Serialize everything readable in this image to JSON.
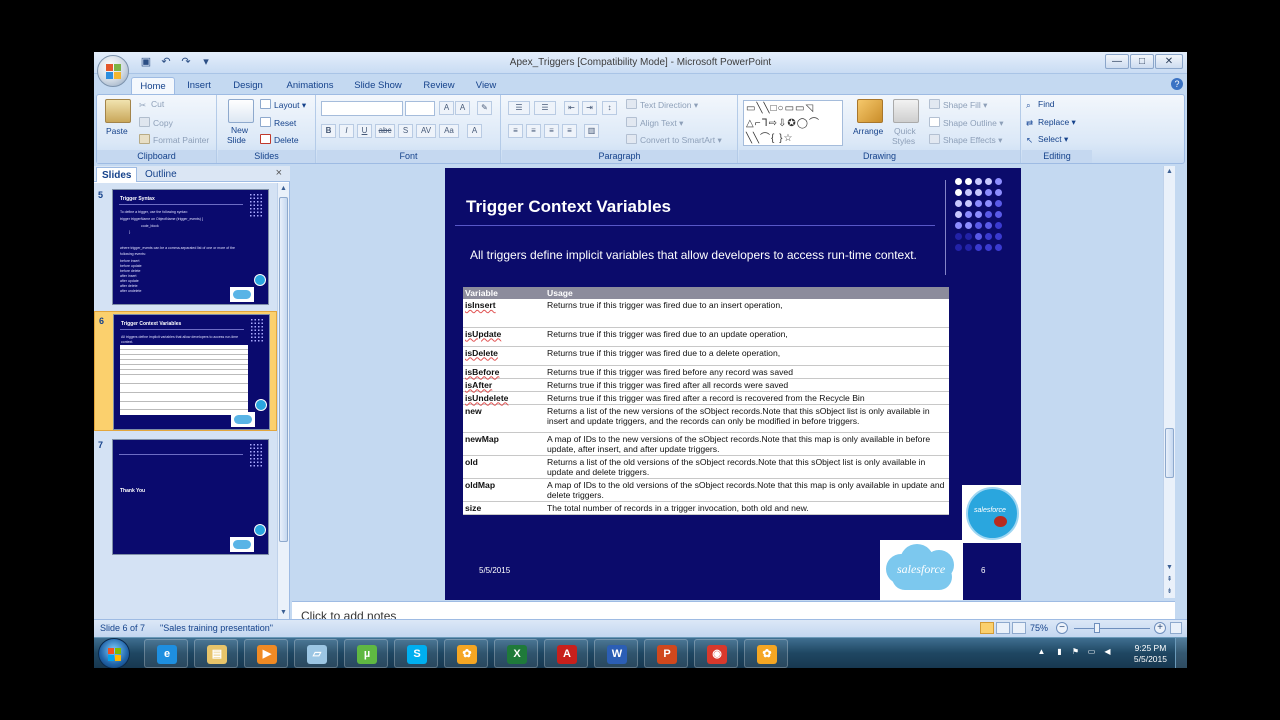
{
  "window": {
    "title": "Apex_Triggers [Compatibility Mode] - Microsoft PowerPoint",
    "min": "—",
    "max": "□",
    "close": "✕"
  },
  "tabs": [
    "Home",
    "Insert",
    "Design",
    "Animations",
    "Slide Show",
    "Review",
    "View"
  ],
  "ribbon": {
    "clipboard": {
      "paste": "Paste",
      "cut": "Cut",
      "copy": "Copy",
      "format_painter": "Format Painter",
      "label": "Clipboard"
    },
    "slides": {
      "new_slide": "New",
      "new_slide2": "Slide",
      "layout": "Layout",
      "reset": "Reset",
      "delete": "Delete",
      "label": "Slides"
    },
    "font": {
      "label": "Font",
      "bold": "B",
      "italic": "I",
      "underline": "U",
      "strike": "abc",
      "shadow": "S",
      "spacing": "AV",
      "case": "Aa",
      "grow": "A",
      "shrink": "A"
    },
    "paragraph": {
      "text_direction": "Text Direction",
      "align_text": "Align Text",
      "smartart": "Convert to SmartArt",
      "label": "Paragraph"
    },
    "drawing": {
      "arrange": "Arrange",
      "quick_styles": "Quick",
      "quick_styles2": "Styles",
      "shape_fill": "Shape Fill",
      "shape_outline": "Shape Outline",
      "shape_effects": "Shape Effects",
      "label": "Drawing"
    },
    "editing": {
      "find": "Find",
      "replace": "Replace",
      "select": "Select",
      "label": "Editing"
    }
  },
  "pane": {
    "tab_slides": "Slides",
    "tab_outline": "Outline",
    "close": "×",
    "thumbs": [
      {
        "num": "5",
        "title": "Trigger Syntax",
        "lines": [
          "To define a trigger, use the following syntax:",
          "trigger triggerName on ObjectName (trigger_events) {",
          "code_block",
          "}",
          "where trigger_events can be a comma-separated list of one or more of the",
          "following events:",
          "before insert",
          "before update",
          "before delete",
          "after insert",
          "after update",
          "after delete",
          "after undelete"
        ]
      },
      {
        "num": "6",
        "title": "Trigger Context Variables",
        "lines": [
          "All triggers define implicit variables that allow developers to access run-time",
          "context."
        ]
      },
      {
        "num": "7",
        "title": "Thank You",
        "lines": []
      }
    ]
  },
  "slide": {
    "title": "Trigger Context Variables",
    "subtitle": "All triggers define implicit variables that allow developers to access run-time context.",
    "date": "5/5/2015",
    "number": "6",
    "logo_text": "salesforce",
    "cloud_text": "salesforce",
    "table": {
      "headers": [
        "Variable",
        "Usage"
      ],
      "rows": [
        [
          "isInsert",
          "Returns true if this trigger was fired due to an insert operation,"
        ],
        [
          "isUpdate",
          "Returns true if this trigger was fired due to an update operation,"
        ],
        [
          "isDelete",
          "Returns true if this trigger was fired due to a delete operation,"
        ],
        [
          "isBefore",
          "Returns true if this trigger was fired before any record was saved"
        ],
        [
          "isAfter",
          "Returns true if this trigger was fired after all records were saved"
        ],
        [
          "isUndelete",
          "Returns true if this trigger was fired after a record is recovered from the Recycle Bin"
        ],
        [
          "new",
          "Returns a list of the new versions of the sObject records.Note that this sObject list is only available in insert and update triggers, and the records can only be modified in before triggers."
        ],
        [
          "newMap",
          "A map of IDs to the new versions of the sObject records.Note that this map is only available in before update, after insert, and after update triggers."
        ],
        [
          "old",
          "Returns a list of the old versions of the sObject records.Note that this sObject list is only available in update and delete triggers."
        ],
        [
          "oldMap",
          "A map of IDs to the old versions of the sObject records.Note that this map is only available in update and delete triggers."
        ],
        [
          "size",
          "The total number of records in a trigger invocation, both old and new."
        ]
      ]
    }
  },
  "notes_placeholder": "Click to add notes",
  "status": {
    "slide_of": "Slide 6 of 7",
    "theme": "\"Sales training presentation\"",
    "zoom": "75%",
    "minus": "−",
    "plus": "+"
  },
  "taskbar": {
    "apps": [
      "ie-icon",
      "explorer-icon",
      "media-player-icon",
      "notepad-icon",
      "utorrent-icon",
      "skype-icon",
      "flower-app-icon",
      "excel-icon",
      "pdf-icon",
      "word-icon",
      "powerpoint-icon",
      "chrome-icon",
      "flower-app-icon"
    ],
    "time": "9:25 PM",
    "date": "5/5/2015"
  }
}
